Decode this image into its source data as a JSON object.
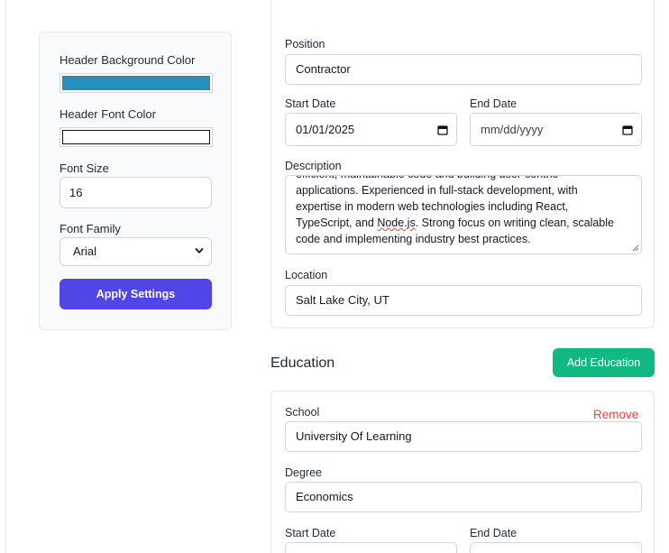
{
  "settings": {
    "header_bg_label": "Header Background Color",
    "header_bg_color": "#2490bd",
    "header_font_label": "Header Font Color",
    "header_font_color": "#ffffff",
    "font_size_label": "Font Size",
    "font_size_value": "16",
    "font_family_label": "Font Family",
    "font_family_value": "Arial",
    "apply_label": "Apply Settings",
    "apply_color": "#4f46e5"
  },
  "experience": {
    "position_label": "Position",
    "position_value": "Contractor",
    "start_label": "Start Date",
    "start_value": "01/01/2025",
    "end_label": "End Date",
    "end_placeholder": "mm/dd/yyyy",
    "description_label": "Description",
    "description_lines": [
      "efficient, maintainable code and building user-centric",
      "applications. Experienced in full-stack development, with",
      "expertise in modern web technologies including React,",
      "TypeScript, and ",
      "Node.js",
      ". Strong focus on writing clean, scalable",
      "code and implementing industry best practices."
    ],
    "location_label": "Location",
    "location_value": "Salt Lake City, UT"
  },
  "education": {
    "section_title": "Education",
    "add_label": "Add Education",
    "add_color": "#10b981",
    "school_label": "School",
    "school_value": "University Of Learning",
    "remove_label": "Remove",
    "degree_label": "Degree",
    "degree_value": "Economics",
    "start_label": "Start Date",
    "end_label": "End Date"
  }
}
